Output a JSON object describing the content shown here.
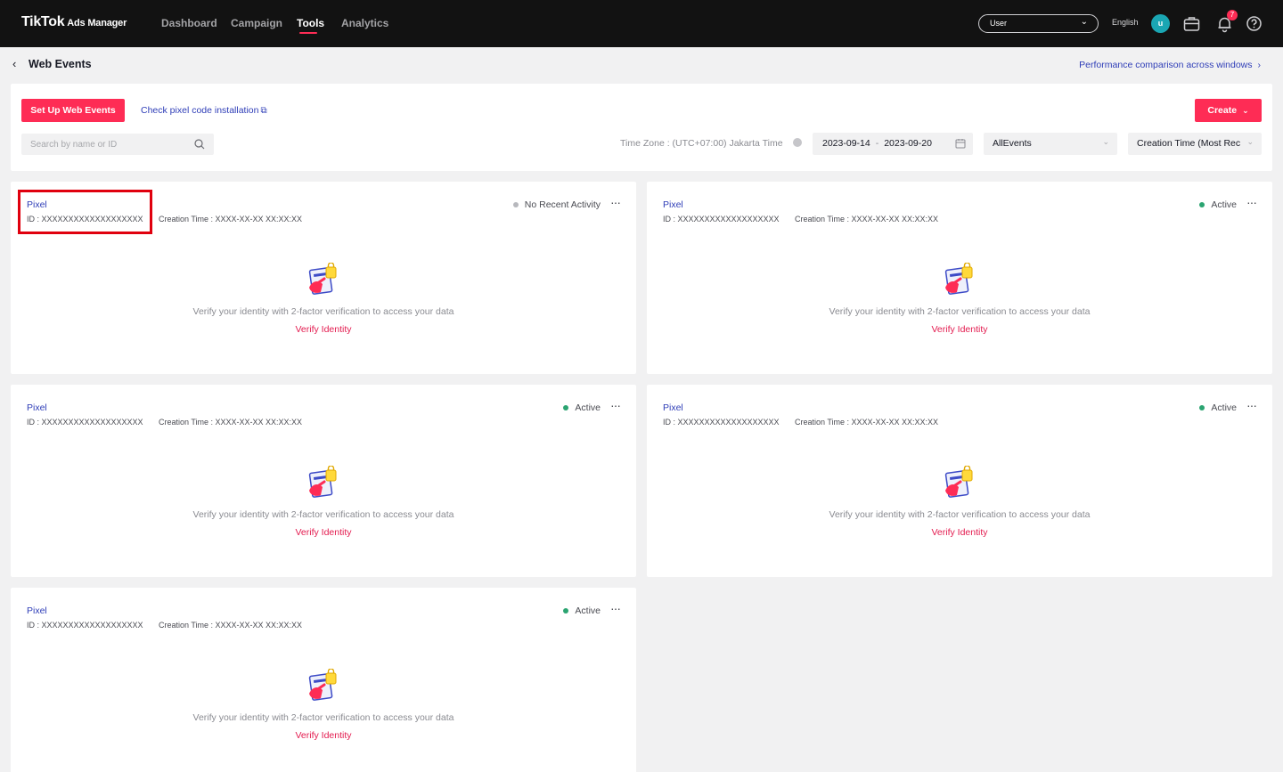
{
  "topnav": {
    "brand": "TikTok",
    "brand_sub": "Ads Manager",
    "items": [
      {
        "label": "Dashboard"
      },
      {
        "label": "Campaign"
      },
      {
        "label": "Tools"
      },
      {
        "label": "Analytics"
      }
    ],
    "active_item": "Tools",
    "user_select": "User",
    "language": "English",
    "avatar_initial": "u",
    "notification_count": "7",
    "accent_color": "#fe2c55"
  },
  "page": {
    "title": "Web Events",
    "perf_link": "Performance comparison across windows"
  },
  "toolbar": {
    "setup_button": "Set Up Web Events",
    "check_link": "Check pixel code installation",
    "create_button": "Create",
    "search_placeholder": "Search by name or ID",
    "timezone": "Time Zone : (UTC+07:00) Jakarta Time",
    "date_start": "2023-09-14",
    "date_end": "2023-09-20",
    "events_filter": "AllEvents",
    "sort": "Creation Time (Most Rec"
  },
  "cards": [
    {
      "name": "Pixel",
      "id": "ID : XXXXXXXXXXXXXXXXXXX",
      "creation": "Creation Time : XXXX-XX-XX XX:XX:XX",
      "status": "No Recent Activity",
      "status_color": "#b7b8bd",
      "message": "Verify your identity with 2-factor verification to access your data",
      "verify": "Verify Identity"
    },
    {
      "name": "Pixel",
      "id": "ID : XXXXXXXXXXXXXXXXXXX",
      "creation": "Creation Time : XXXX-XX-XX XX:XX:XX",
      "status": "Active",
      "status_color": "#2ba471",
      "message": "Verify your identity with 2-factor verification to access your data",
      "verify": "Verify Identity"
    },
    {
      "name": "Pixel",
      "id": "ID : XXXXXXXXXXXXXXXXXXX",
      "creation": "Creation Time : XXXX-XX-XX XX:XX:XX",
      "status": "Active",
      "status_color": "#2ba471",
      "message": "Verify your identity with 2-factor verification to access your data",
      "verify": "Verify Identity"
    },
    {
      "name": "Pixel",
      "id": "ID : XXXXXXXXXXXXXXXXXXX",
      "creation": "Creation Time : XXXX-XX-XX XX:XX:XX",
      "status": "Active",
      "status_color": "#2ba471",
      "message": "Verify your identity with 2-factor verification to access your data",
      "verify": "Verify Identity"
    },
    {
      "name": "Pixel",
      "id": "ID : XXXXXXXXXXXXXXXXXXX",
      "creation": "Creation Time : XXXX-XX-XX XX:XX:XX",
      "status": "Active",
      "status_color": "#2ba471",
      "message": "Verify your identity with 2-factor verification to access your data",
      "verify": "Verify Identity"
    }
  ]
}
